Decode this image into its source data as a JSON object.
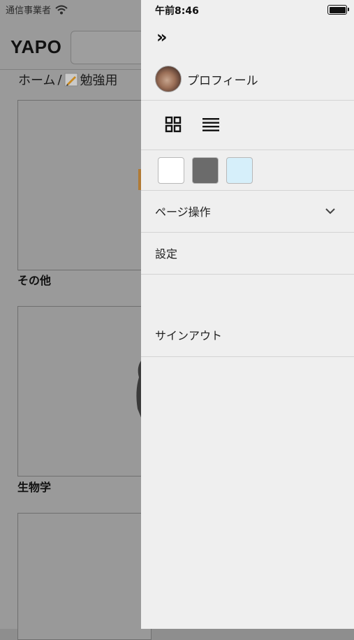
{
  "status": {
    "carrier": "通信事業者",
    "time": "午前8:46"
  },
  "app": {
    "logo": "YAPO"
  },
  "breadcrumb": {
    "home": "ホーム",
    "sep": " / ",
    "current": "勉強用"
  },
  "cards": [
    {
      "label": "その他"
    },
    {
      "label": "生物学"
    },
    {
      "label": ""
    }
  ],
  "drawer": {
    "collapse_glyph": "»",
    "profile_label": "プロフィール",
    "swatches": [
      {
        "name": "white",
        "color": "#ffffff"
      },
      {
        "name": "gray",
        "color": "#6b6b6b"
      },
      {
        "name": "light-blue",
        "color": "#d6effa"
      }
    ],
    "menu": {
      "page_ops": "ページ操作",
      "settings": "設定",
      "sign_out": "サインアウト"
    }
  },
  "icons": [
    "wifi-icon",
    "battery-icon",
    "pencil-icon",
    "grid-view-icon",
    "list-view-icon",
    "chevron-down-icon"
  ]
}
